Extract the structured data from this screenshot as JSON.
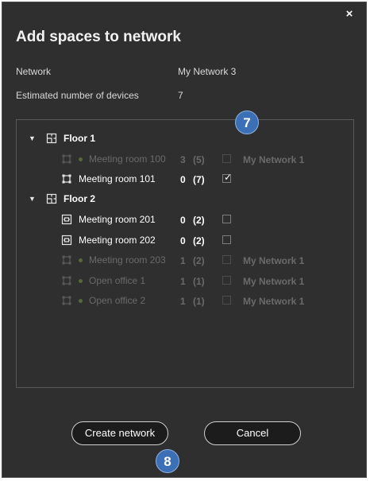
{
  "dialog": {
    "title": "Add spaces to network",
    "close_glyph": "×"
  },
  "info": {
    "network_label": "Network",
    "network_value": "My Network 3",
    "devices_label": "Estimated number of devices",
    "devices_value": "7"
  },
  "badges": {
    "step_top": "7",
    "step_bottom": "8"
  },
  "tree": {
    "floors": [
      {
        "label": "Floor 1",
        "icon": "floor-plan-icon",
        "expanded": true
      },
      {
        "label": "Floor 2",
        "icon": "floor-plan-icon",
        "expanded": true
      }
    ],
    "rooms": [
      {
        "label": "Meeting room 100",
        "count": "3",
        "total": "(5)",
        "checked": false,
        "network": "My Network 1",
        "disabled": true,
        "icon": "room-corners-icon"
      },
      {
        "label": "Meeting room 101",
        "count": "0",
        "total": "(7)",
        "checked": true,
        "network": "",
        "disabled": false,
        "icon": "room-corners-icon"
      },
      {
        "label": "Meeting room 201",
        "count": "0",
        "total": "(2)",
        "checked": false,
        "network": "",
        "disabled": false,
        "icon": "meeting-table-icon"
      },
      {
        "label": "Meeting room 202",
        "count": "0",
        "total": "(2)",
        "checked": false,
        "network": "",
        "disabled": false,
        "icon": "meeting-table-icon"
      },
      {
        "label": "Meeting room 203",
        "count": "1",
        "total": "(2)",
        "checked": false,
        "network": "My Network 1",
        "disabled": true,
        "icon": "room-corners-icon"
      },
      {
        "label": "Open office 1",
        "count": "1",
        "total": "(1)",
        "checked": false,
        "network": "My Network 1",
        "disabled": true,
        "icon": "room-corners-icon"
      },
      {
        "label": "Open office 2",
        "count": "1",
        "total": "(1)",
        "checked": false,
        "network": "My Network 1",
        "disabled": true,
        "icon": "room-corners-icon"
      }
    ]
  },
  "buttons": {
    "create": "Create network",
    "cancel": "Cancel"
  },
  "colors": {
    "background": "#2f2f2f",
    "badge": "#3b6fb6",
    "disabled_text": "#6a6a6a",
    "assigned_dot": "#55693a"
  }
}
